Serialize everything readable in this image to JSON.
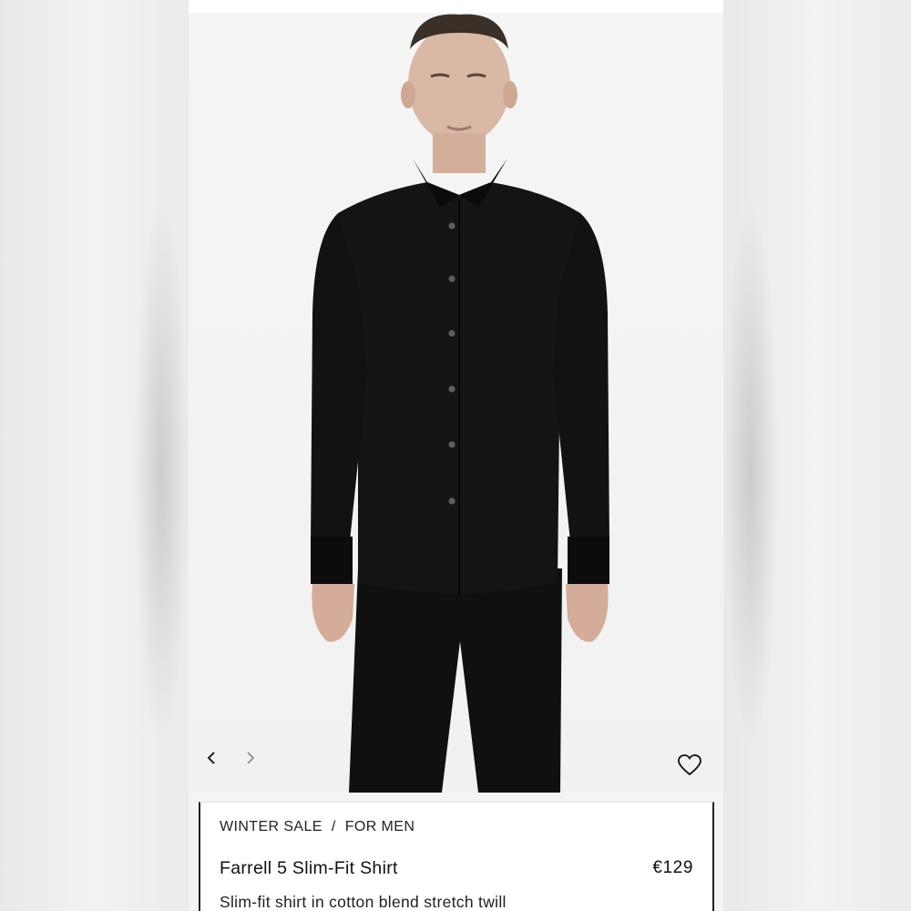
{
  "product": {
    "breadcrumb": [
      {
        "label": "WINTER SALE"
      },
      {
        "label": "FOR MEN"
      }
    ],
    "breadcrumb_separator": "/",
    "name": "Farrell 5 Slim-Fit Shirt",
    "price": "€129",
    "description": "Slim-fit shirt in cotton blend stretch twill"
  },
  "gallery": {
    "prev_icon": "chevron-left-icon",
    "next_icon": "chevron-right-icon",
    "favorite_icon": "heart-outline-icon"
  },
  "colors": {
    "background": "#f4f4f4",
    "text": "#111111",
    "shirt": "#111111"
  }
}
